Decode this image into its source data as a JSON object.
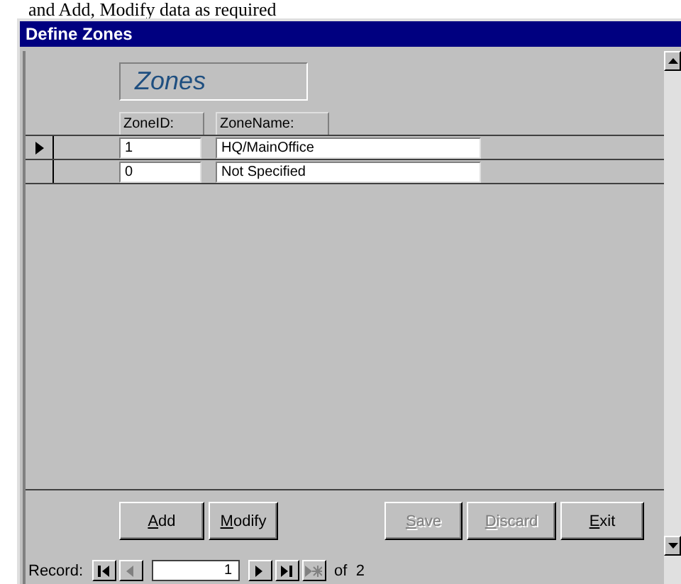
{
  "document_text": "and Add, Modify data as required",
  "window": {
    "title": "Define Zones"
  },
  "header": {
    "label": "Zones"
  },
  "columns": [
    "ZoneID:",
    "ZoneName:"
  ],
  "rows": [
    {
      "current": true,
      "cells": [
        "1",
        "HQ/MainOffice"
      ]
    },
    {
      "current": false,
      "cells": [
        "0",
        "Not Specified"
      ]
    }
  ],
  "edit_buttons": [
    {
      "accel": "A",
      "rest": "dd",
      "disabled": false
    },
    {
      "accel": "M",
      "rest": "odify",
      "disabled": false
    }
  ],
  "save_buttons": [
    {
      "accel": "S",
      "rest": "ave",
      "disabled": true
    },
    {
      "accel": "D",
      "rest": "iscard",
      "disabled": true
    },
    {
      "accel": "E",
      "rest": "xit",
      "disabled": false
    }
  ],
  "navigator": {
    "label": "Record:",
    "value": "1",
    "total": "of  2",
    "controls": [
      {
        "kind": "first",
        "disabled": false
      },
      {
        "kind": "prev",
        "disabled": true
      },
      {
        "kind": "next",
        "disabled": false
      },
      {
        "kind": "last",
        "disabled": false
      },
      {
        "kind": "new",
        "disabled": true
      }
    ]
  }
}
